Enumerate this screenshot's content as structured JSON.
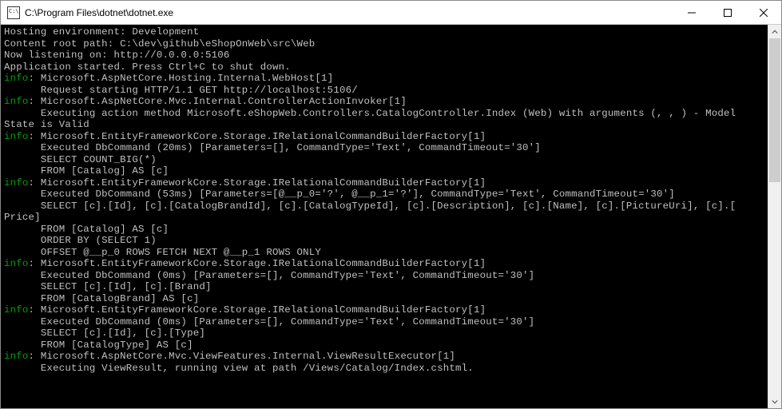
{
  "window": {
    "title": "C:\\Program Files\\dotnet\\dotnet.exe"
  },
  "console": {
    "lines": [
      {
        "parts": [
          {
            "text": "Hosting environment: Development"
          }
        ]
      },
      {
        "parts": [
          {
            "text": "Content root path: C:\\dev\\github\\eShopOnWeb\\src\\Web"
          }
        ]
      },
      {
        "parts": [
          {
            "text": "Now listening on: http://0.0.0.0:5106"
          }
        ]
      },
      {
        "parts": [
          {
            "text": "Application started. Press Ctrl+C to shut down."
          }
        ]
      },
      {
        "parts": [
          {
            "cls": "info-level",
            "text": "info"
          },
          {
            "text": ": Microsoft.AspNetCore.Hosting.Internal.WebHost[1]"
          }
        ]
      },
      {
        "parts": [
          {
            "text": "      Request starting HTTP/1.1 GET http://localhost:5106/"
          }
        ]
      },
      {
        "parts": [
          {
            "cls": "info-level",
            "text": "info"
          },
          {
            "text": ": Microsoft.AspNetCore.Mvc.Internal.ControllerActionInvoker[1]"
          }
        ]
      },
      {
        "parts": [
          {
            "text": "      Executing action method Microsoft.eShopWeb.Controllers.CatalogController.Index (Web) with arguments (, , ) - Model"
          }
        ]
      },
      {
        "parts": [
          {
            "text": "State is Valid"
          }
        ]
      },
      {
        "parts": [
          {
            "cls": "info-level",
            "text": "info"
          },
          {
            "text": ": Microsoft.EntityFrameworkCore.Storage.IRelationalCommandBuilderFactory[1]"
          }
        ]
      },
      {
        "parts": [
          {
            "text": "      Executed DbCommand (20ms) [Parameters=[], CommandType='Text', CommandTimeout='30']"
          }
        ]
      },
      {
        "parts": [
          {
            "text": "      SELECT COUNT_BIG(*)"
          }
        ]
      },
      {
        "parts": [
          {
            "text": "      FROM [Catalog] AS [c]"
          }
        ]
      },
      {
        "parts": [
          {
            "cls": "info-level",
            "text": "info"
          },
          {
            "text": ": Microsoft.EntityFrameworkCore.Storage.IRelationalCommandBuilderFactory[1]"
          }
        ]
      },
      {
        "parts": [
          {
            "text": "      Executed DbCommand (53ms) [Parameters=[@__p_0='?', @__p_1='?'], CommandType='Text', CommandTimeout='30']"
          }
        ]
      },
      {
        "parts": [
          {
            "text": "      SELECT [c].[Id], [c].[CatalogBrandId], [c].[CatalogTypeId], [c].[Description], [c].[Name], [c].[PictureUri], [c].["
          }
        ]
      },
      {
        "parts": [
          {
            "text": "Price]"
          }
        ]
      },
      {
        "parts": [
          {
            "text": "      FROM [Catalog] AS [c]"
          }
        ]
      },
      {
        "parts": [
          {
            "text": "      ORDER BY (SELECT 1)"
          }
        ]
      },
      {
        "parts": [
          {
            "text": "      OFFSET @__p_0 ROWS FETCH NEXT @__p_1 ROWS ONLY"
          }
        ]
      },
      {
        "parts": [
          {
            "cls": "info-level",
            "text": "info"
          },
          {
            "text": ": Microsoft.EntityFrameworkCore.Storage.IRelationalCommandBuilderFactory[1]"
          }
        ]
      },
      {
        "parts": [
          {
            "text": "      Executed DbCommand (0ms) [Parameters=[], CommandType='Text', CommandTimeout='30']"
          }
        ]
      },
      {
        "parts": [
          {
            "text": "      SELECT [c].[Id], [c].[Brand]"
          }
        ]
      },
      {
        "parts": [
          {
            "text": "      FROM [CatalogBrand] AS [c]"
          }
        ]
      },
      {
        "parts": [
          {
            "cls": "info-level",
            "text": "info"
          },
          {
            "text": ": Microsoft.EntityFrameworkCore.Storage.IRelationalCommandBuilderFactory[1]"
          }
        ]
      },
      {
        "parts": [
          {
            "text": "      Executed DbCommand (0ms) [Parameters=[], CommandType='Text', CommandTimeout='30']"
          }
        ]
      },
      {
        "parts": [
          {
            "text": "      SELECT [c].[Id], [c].[Type]"
          }
        ]
      },
      {
        "parts": [
          {
            "text": "      FROM [CatalogType] AS [c]"
          }
        ]
      },
      {
        "parts": [
          {
            "cls": "info-level",
            "text": "info"
          },
          {
            "text": ": Microsoft.AspNetCore.Mvc.ViewFeatures.Internal.ViewResultExecutor[1]"
          }
        ]
      },
      {
        "parts": [
          {
            "text": "      Executing ViewResult, running view at path /Views/Catalog/Index.cshtml."
          }
        ]
      }
    ]
  }
}
